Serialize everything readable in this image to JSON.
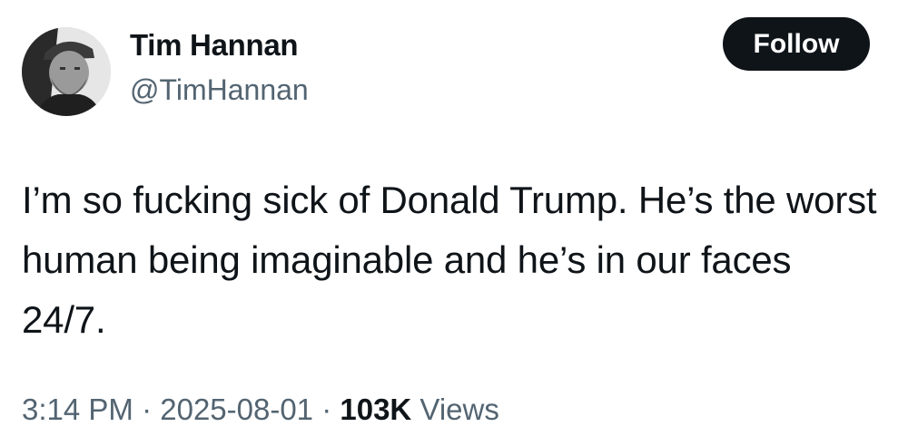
{
  "author": {
    "display_name": "Tim Hannan",
    "handle": "@TimHannan"
  },
  "follow_button": {
    "label": "Follow"
  },
  "tweet": {
    "text": "I’m so fucking sick of Donald Trump. He’s the worst human being imaginable and he’s in our faces 24/7."
  },
  "meta": {
    "time": "3:14 PM",
    "separator": " · ",
    "date": "2025-08-01",
    "views_count": "103K",
    "views_label": " Views"
  },
  "colors": {
    "text_primary": "#0f1419",
    "text_secondary": "#536471",
    "button_bg": "#0f1419",
    "button_text": "#ffffff"
  }
}
